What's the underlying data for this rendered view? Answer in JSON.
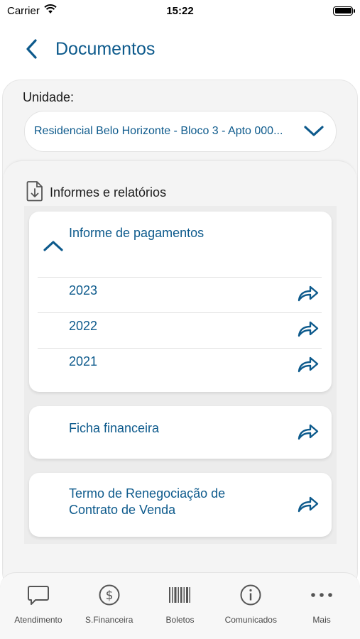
{
  "status": {
    "carrier": "Carrier",
    "time": "15:22"
  },
  "header": {
    "title": "Documentos"
  },
  "unit": {
    "label": "Unidade:",
    "selected": "Residencial Belo Horizonte - Bloco 3 - Apto 000..."
  },
  "section": {
    "title": "Informes e relatórios",
    "icon": "document-download-icon"
  },
  "documents": {
    "payments": {
      "title": "Informe de pagamentos",
      "years": [
        "2023",
        "2022",
        "2021"
      ]
    },
    "ficha": {
      "title": "Ficha financeira"
    },
    "termo": {
      "title_line1": "Termo de Renegociação de",
      "title_line2": "Contrato de Venda"
    }
  },
  "tabs": [
    {
      "label": "Atendimento",
      "icon": "chat-bubble-icon"
    },
    {
      "label": "S.Financeira",
      "icon": "dollar-circle-icon"
    },
    {
      "label": "Boletos",
      "icon": "barcode-icon"
    },
    {
      "label": "Comunicados",
      "icon": "info-circle-icon"
    },
    {
      "label": "Mais",
      "icon": "more-dots-icon"
    }
  ],
  "colors": {
    "accent": "#0d5a8c",
    "text": "#1b1b1b",
    "tab_text": "#4a4a4a"
  }
}
